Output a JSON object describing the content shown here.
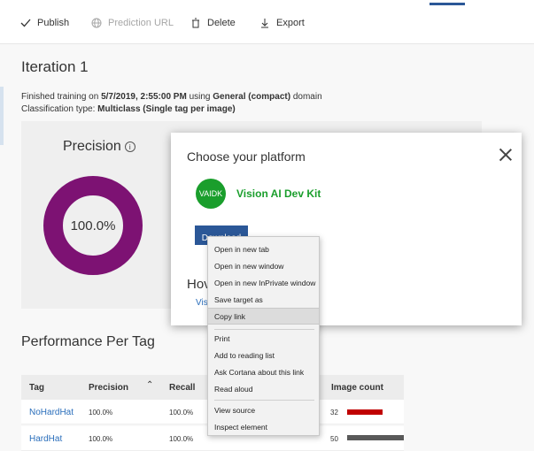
{
  "toolbar": {
    "publish": "Publish",
    "prediction_url": "Prediction URL",
    "delete": "Delete",
    "export": "Export"
  },
  "iteration": {
    "title": "Iteration 1",
    "finished_prefix": "Finished training on ",
    "finished_date": "5/7/2019, 2:55:00 PM",
    "using": " using ",
    "domain_name": "General (compact)",
    "domain_suffix": " domain",
    "class_prefix": "Classification type: ",
    "class_value": "Multiclass (Single tag per image)"
  },
  "precision": {
    "title": "Precision",
    "value": "100.0%",
    "fraction": 1.0,
    "color": "#7d1273"
  },
  "performance": {
    "title": "Performance Per Tag",
    "columns": [
      "Tag",
      "Precision",
      "Recall",
      "Image count"
    ],
    "rows": [
      {
        "tag": "NoHardHat",
        "precision": "100.0%",
        "recall": "100.0%",
        "image_count": "32",
        "bar_color": "#c00000"
      },
      {
        "tag": "HardHat",
        "precision": "100.0%",
        "recall": "100.0%",
        "image_count": "50",
        "bar_color": "#595959"
      }
    ]
  },
  "modal": {
    "title": "Choose your platform",
    "logo_text": "VAIDK",
    "platform_name": "Vision AI Dev Kit",
    "download_label": "Download",
    "how_text": "Hov",
    "visi_text": "Visi",
    "accent_color": "#1a9e2c",
    "button_color": "#2b5797"
  },
  "context_menu": {
    "items": [
      "Open in new tab",
      "Open in new window",
      "Open in new InPrivate window",
      "Save target as",
      "Copy link",
      "Print",
      "Add to reading list",
      "Ask Cortana about this link",
      "Read aloud",
      "View source",
      "Inspect element"
    ],
    "highlighted": "Copy link"
  }
}
